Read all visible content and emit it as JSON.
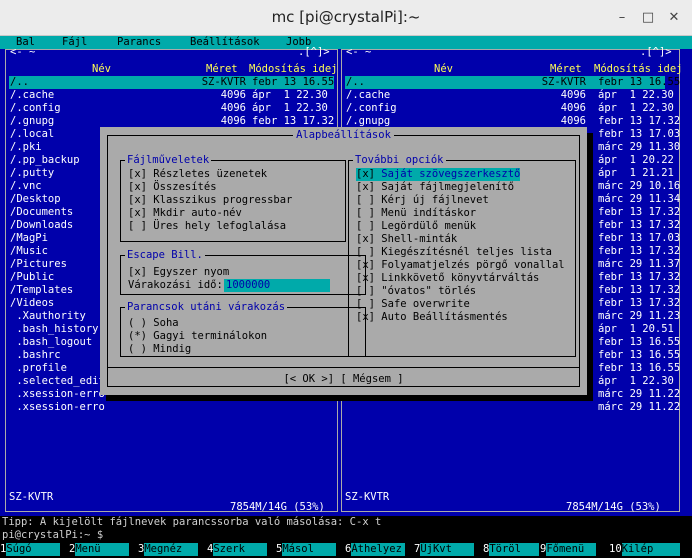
{
  "window": {
    "title": "mc [pi@crystalPi]:~",
    "minimize": "–",
    "maximize": "□",
    "close": "✕"
  },
  "menubar": [
    "Bal",
    "Fájl",
    "Parancs",
    "Beállítások",
    "Jobb"
  ],
  "left_panel": {
    "top_left": "<- ~",
    "top_right": ".[^]>",
    "headers": {
      "name": "Név",
      "size": "Méret",
      "mtime": "Módosítás idej"
    },
    "rows": [
      {
        "name": "/..",
        "size": "SZ-KVTR",
        "mtime": "febr 13 16.55"
      },
      {
        "name": "/.cache",
        "size": "4096",
        "mtime": "ápr  1 22.30"
      },
      {
        "name": "/.config",
        "size": "4096",
        "mtime": "ápr  1 22.30"
      },
      {
        "name": "/.gnupg",
        "size": "4096",
        "mtime": "febr 13 17.32"
      },
      {
        "name": "/.local",
        "size": "",
        "mtime": ""
      },
      {
        "name": "/.pki",
        "size": "",
        "mtime": ""
      },
      {
        "name": "/.pp_backup",
        "size": "",
        "mtime": ""
      },
      {
        "name": "/.putty",
        "size": "",
        "mtime": ""
      },
      {
        "name": "/.vnc",
        "size": "",
        "mtime": ""
      },
      {
        "name": "/Desktop",
        "size": "",
        "mtime": ""
      },
      {
        "name": "/Documents",
        "size": "",
        "mtime": ""
      },
      {
        "name": "/Downloads",
        "size": "",
        "mtime": ""
      },
      {
        "name": "/MagPi",
        "size": "",
        "mtime": ""
      },
      {
        "name": "/Music",
        "size": "",
        "mtime": ""
      },
      {
        "name": "/Pictures",
        "size": "",
        "mtime": ""
      },
      {
        "name": "/Public",
        "size": "",
        "mtime": ""
      },
      {
        "name": "/Templates",
        "size": "",
        "mtime": ""
      },
      {
        "name": "/Videos",
        "size": "",
        "mtime": ""
      },
      {
        "name": " .Xauthority",
        "size": "",
        "mtime": ""
      },
      {
        "name": " .bash_history",
        "size": "",
        "mtime": ""
      },
      {
        "name": " .bash_logout",
        "size": "",
        "mtime": ""
      },
      {
        "name": " .bashrc",
        "size": "",
        "mtime": ""
      },
      {
        "name": " .profile",
        "size": "",
        "mtime": ""
      },
      {
        "name": " .selected_edit",
        "size": "",
        "mtime": ""
      },
      {
        "name": " .xsession-erro",
        "size": "",
        "mtime": ""
      },
      {
        "name": " .xsession-erro",
        "size": "",
        "mtime": ""
      }
    ],
    "status": "SZ-KVTR",
    "disk": "7854M/14G (53%)"
  },
  "right_panel": {
    "top_left": "<- ~",
    "top_right": ".[^]>",
    "headers": {
      "name": "Név",
      "size": "Méret",
      "mtime": "Módosítás idej"
    },
    "rows": [
      {
        "name": "/..",
        "size": "SZ-KVTR",
        "mtime": "febr 13 16.55"
      },
      {
        "name": "/.cache",
        "size": "4096",
        "mtime": "ápr  1 22.30"
      },
      {
        "name": "/.config",
        "size": "4096",
        "mtime": "ápr  1 22.30"
      },
      {
        "name": "/.gnupg",
        "size": "4096",
        "mtime": "febr 13 17.32"
      },
      {
        "name": "",
        "size": "",
        "mtime": "febr 13 17.03"
      },
      {
        "name": "",
        "size": "",
        "mtime": "márc 29 11.30"
      },
      {
        "name": "",
        "size": "",
        "mtime": "ápr  1 20.22"
      },
      {
        "name": "",
        "size": "",
        "mtime": "ápr  1 21.21"
      },
      {
        "name": "",
        "size": "",
        "mtime": "márc 29 10.16"
      },
      {
        "name": "",
        "size": "",
        "mtime": "márc 29 11.34"
      },
      {
        "name": "",
        "size": "",
        "mtime": "febr 13 17.32"
      },
      {
        "name": "",
        "size": "",
        "mtime": "febr 13 17.32"
      },
      {
        "name": "",
        "size": "",
        "mtime": "febr 13 17.03"
      },
      {
        "name": "",
        "size": "",
        "mtime": "febr 13 17.32"
      },
      {
        "name": "",
        "size": "",
        "mtime": "márc 29 11.37"
      },
      {
        "name": "",
        "size": "",
        "mtime": "febr 13 17.32"
      },
      {
        "name": "",
        "size": "",
        "mtime": "febr 13 17.32"
      },
      {
        "name": "",
        "size": "",
        "mtime": "febr 13 17.32"
      },
      {
        "name": "",
        "size": "",
        "mtime": "márc 29 11.23"
      },
      {
        "name": "",
        "size": "",
        "mtime": "ápr  1 20.51"
      },
      {
        "name": "",
        "size": "",
        "mtime": "febr 13 16.55"
      },
      {
        "name": "",
        "size": "",
        "mtime": "febr 13 16.55"
      },
      {
        "name": "",
        "size": "",
        "mtime": "febr 13 16.55"
      },
      {
        "name": "",
        "size": "",
        "mtime": "ápr  1 22.30"
      },
      {
        "name": "",
        "size": "",
        "mtime": "márc 29 11.22"
      },
      {
        "name": "",
        "size": "",
        "mtime": "márc 29 11.22"
      }
    ],
    "status": "SZ-KVTR",
    "disk": "7854M/14G (53%)"
  },
  "dialog": {
    "title": "Alapbeállítások",
    "file_ops": {
      "title": "Fájlműveletek",
      "items": [
        {
          "mark": "[x]",
          "label": "Részletes üzenetek"
        },
        {
          "mark": "[x]",
          "label": "Összesítés"
        },
        {
          "mark": "[x]",
          "label": "Klasszikus progressbar"
        },
        {
          "mark": "[x]",
          "label": "Mkdir auto-név"
        },
        {
          "mark": "[ ]",
          "label": "Üres hely lefoglalása"
        }
      ]
    },
    "esc": {
      "title": "Escape Bill.",
      "single": {
        "mark": "[x]",
        "label": "Egyszer nyom"
      },
      "timeout_label": "Várakozási idő:",
      "timeout_value": "1000000"
    },
    "pause": {
      "title": "Parancsok utáni várakozás",
      "items": [
        {
          "mark": "( )",
          "label": "Soha"
        },
        {
          "mark": "(*)",
          "label": "Gagyi terminálokon"
        },
        {
          "mark": "( )",
          "label": "Mindig"
        }
      ]
    },
    "other": {
      "title": "További opciók",
      "items": [
        {
          "mark": "[x]",
          "label": "Saját szövegszerkesztő"
        },
        {
          "mark": "[x]",
          "label": "Saját fájlmegjelenítő"
        },
        {
          "mark": "[ ]",
          "label": "Kérj új fájlnevet"
        },
        {
          "mark": "[ ]",
          "label": "Menü indításkor"
        },
        {
          "mark": "[ ]",
          "label": "Legördülő menük"
        },
        {
          "mark": "[x]",
          "label": "Shell-minták"
        },
        {
          "mark": "[ ]",
          "label": "Kiegészítésnél teljes lista"
        },
        {
          "mark": "[x]",
          "label": "Folyamatjelzés pörgő vonallal"
        },
        {
          "mark": "[x]",
          "label": "Linkkövető könyvtárváltás"
        },
        {
          "mark": "[ ]",
          "label": "\"óvatos\" törlés"
        },
        {
          "mark": "[ ]",
          "label": "Safe overwrite"
        },
        {
          "mark": "[x]",
          "label": "Auto Beállításmentés"
        }
      ]
    },
    "ok": "[< OK >]",
    "cancel": "[ Mégsem ]"
  },
  "hint": "Tipp: A kijelölt fájlnevek parancssorba való másolása: C-x t",
  "prompt": "pi@crystalPi:~ $",
  "keys": [
    {
      "num": "1",
      "label": "Súgó"
    },
    {
      "num": "2",
      "label": "Menü"
    },
    {
      "num": "3",
      "label": "Megnéz"
    },
    {
      "num": "4",
      "label": "Szerk"
    },
    {
      "num": "5",
      "label": "Másol"
    },
    {
      "num": "6",
      "label": "Áthelyez"
    },
    {
      "num": "7",
      "label": "ÚjKvt"
    },
    {
      "num": "8",
      "label": "Töröl"
    },
    {
      "num": "9",
      "label": "Főmenü"
    },
    {
      "num": "10",
      "label": "Kilép"
    }
  ],
  "colors": {
    "panel_bg": "#0000ab",
    "cursor": "#00aaaa",
    "dialog_bg": "#aaaaaa",
    "header": "#ffff55"
  }
}
